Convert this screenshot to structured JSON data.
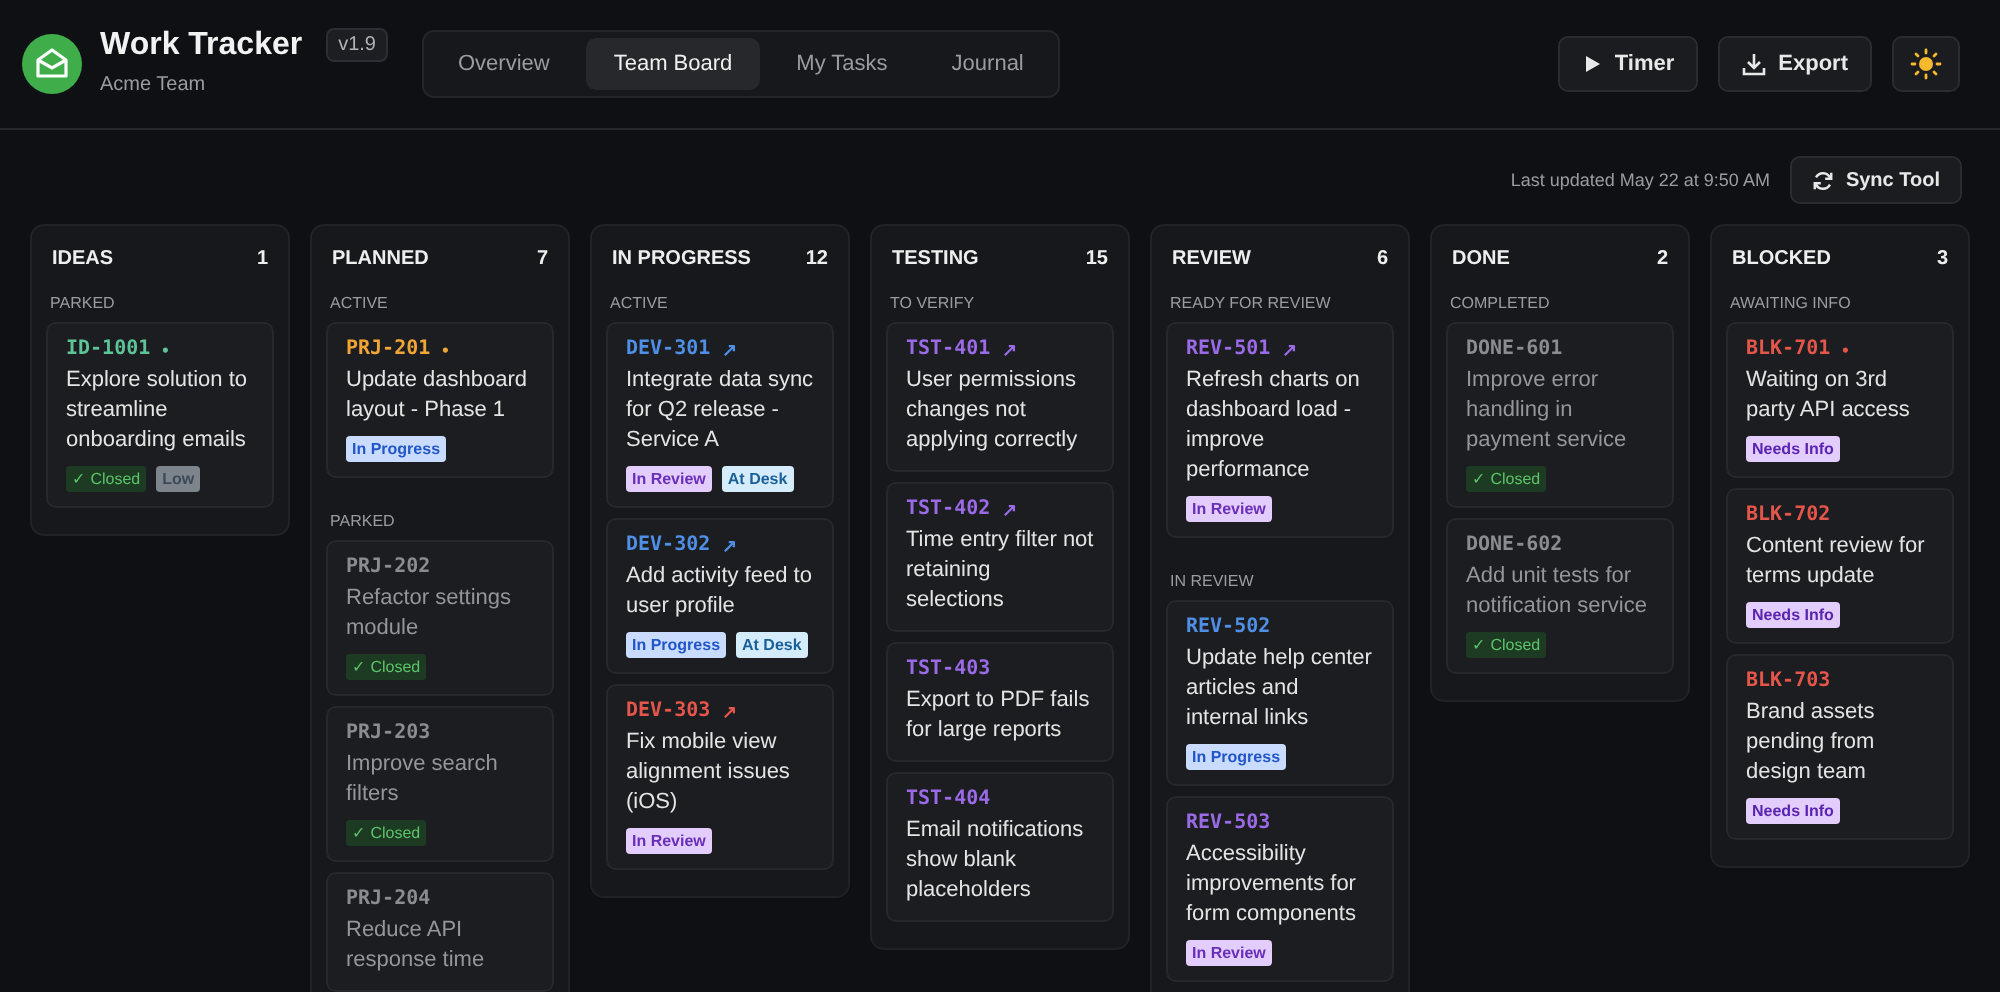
{
  "app": {
    "title": "Work Tracker",
    "version": "v1.9",
    "team": "Acme Team"
  },
  "tabs": [
    {
      "label": "Overview",
      "selected": false
    },
    {
      "label": "Team Board",
      "selected": true
    },
    {
      "label": "My Tasks",
      "selected": false
    },
    {
      "label": "Journal",
      "selected": false
    }
  ],
  "actions": [
    {
      "kind": "timer",
      "label": "Timer"
    },
    {
      "kind": "export",
      "label": "Export"
    },
    {
      "kind": "theme"
    }
  ],
  "last_updated": "Last updated May 22 at 9:50 AM",
  "sync_button": "Sync Tool",
  "columns": [
    {
      "title": "IDEAS",
      "count": "1",
      "sections": [
        {
          "label": "PARKED",
          "cards": [
            {
              "id": "ID-1001",
              "color": "#5cc497",
              "marker": "•",
              "muted": false,
              "text": "Explore solution to streamline onboarding emails",
              "tags": [
                {
                  "kind": "closed",
                  "label": "✓ Closed"
                },
                {
                  "kind": "low",
                  "label": "Low"
                }
              ]
            }
          ]
        }
      ]
    },
    {
      "title": "PLANNED",
      "count": "7",
      "sections": [
        {
          "label": "ACTIVE",
          "cards": [
            {
              "id": "PRJ-201",
              "color": "#f0a535",
              "marker": "•",
              "muted": false,
              "text": "Update dashboard layout - Phase 1",
              "tags": [
                {
                  "kind": "progress",
                  "label": "In Progress"
                }
              ]
            }
          ]
        },
        {
          "label": "PARKED",
          "cards": [
            {
              "id": "PRJ-202",
              "color": "#8a8c90",
              "muted": true,
              "text": "Refactor settings module",
              "tags": [
                {
                  "kind": "closed",
                  "label": "✓ Closed"
                }
              ]
            },
            {
              "id": "PRJ-203",
              "color": "#8a8c90",
              "muted": true,
              "text": "Improve search filters",
              "tags": [
                {
                  "kind": "closed",
                  "label": "✓ Closed"
                }
              ]
            },
            {
              "id": "PRJ-204",
              "color": "#8a8c90",
              "muted": true,
              "text": "Reduce API response time"
            }
          ]
        }
      ]
    },
    {
      "title": "IN PROGRESS",
      "count": "12",
      "sections": [
        {
          "label": "ACTIVE",
          "cards": [
            {
              "id": "DEV-301",
              "color": "#4f8fe6",
              "marker": "↗",
              "muted": false,
              "text": "Integrate data sync for Q2 release - Service A",
              "tags": [
                {
                  "kind": "review",
                  "label": "In Review"
                },
                {
                  "kind": "desk",
                  "label": "At Desk"
                }
              ]
            },
            {
              "id": "DEV-302",
              "color": "#4f8fe6",
              "marker": "↗",
              "muted": false,
              "text": "Add activity feed to user profile",
              "tags": [
                {
                  "kind": "progress",
                  "label": "In Progress"
                },
                {
                  "kind": "desk",
                  "label": "At Desk"
                }
              ]
            },
            {
              "id": "DEV-303",
              "color": "#e5564a",
              "marker": "↗",
              "muted": false,
              "text": "Fix mobile view alignment issues (iOS)",
              "tags": [
                {
                  "kind": "review",
                  "label": "In Review"
                }
              ]
            }
          ]
        }
      ]
    },
    {
      "title": "TESTING",
      "count": "15",
      "sections": [
        {
          "label": "TO VERIFY",
          "cards": [
            {
              "id": "TST-401",
              "color": "#9b6ae6",
              "marker": "↗",
              "muted": false,
              "text": "User permissions changes not applying correctly"
            },
            {
              "id": "TST-402",
              "color": "#9b6ae6",
              "marker": "↗",
              "muted": false,
              "text": "Time entry filter not retaining selections"
            },
            {
              "id": "TST-403",
              "color": "#9b6ae6",
              "muted": false,
              "text": "Export to PDF fails for large reports"
            },
            {
              "id": "TST-404",
              "color": "#9b6ae6",
              "muted": false,
              "text": "Email notifications show blank placeholders"
            }
          ]
        }
      ]
    },
    {
      "title": "REVIEW",
      "count": "6",
      "sections": [
        {
          "label": "READY FOR REVIEW",
          "cards": [
            {
              "id": "REV-501",
              "color": "#9b6ae6",
              "marker": "↗",
              "muted": false,
              "text": "Refresh charts on dashboard load - improve performance",
              "tags": [
                {
                  "kind": "review",
                  "label": "In Review"
                }
              ]
            }
          ]
        },
        {
          "label": "IN REVIEW",
          "cards": [
            {
              "id": "REV-502",
              "color": "#4f8fe6",
              "muted": false,
              "text": "Update help center articles and internal links",
              "tags": [
                {
                  "kind": "progress",
                  "label": "In Progress"
                }
              ]
            },
            {
              "id": "REV-503",
              "color": "#9b6ae6",
              "muted": false,
              "text": "Accessibility improvements for form components",
              "tags": [
                {
                  "kind": "review",
                  "label": "In Review"
                }
              ]
            }
          ]
        }
      ]
    },
    {
      "title": "DONE",
      "count": "2",
      "sections": [
        {
          "label": "COMPLETED",
          "cards": [
            {
              "id": "DONE-601",
              "color": "#8a8c90",
              "muted": true,
              "text": "Improve error handling in payment service",
              "tags": [
                {
                  "kind": "closed",
                  "label": "✓ Closed"
                }
              ]
            },
            {
              "id": "DONE-602",
              "color": "#8a8c90",
              "muted": true,
              "text": "Add unit tests for notification service",
              "tags": [
                {
                  "kind": "closed",
                  "label": "✓ Closed"
                }
              ]
            }
          ]
        }
      ]
    },
    {
      "title": "BLOCKED",
      "count": "3",
      "sections": [
        {
          "label": "AWAITING INFO",
          "cards": [
            {
              "id": "BLK-701",
              "color": "#e5564a",
              "marker": "•",
              "muted": false,
              "text": "Waiting on 3rd party API access",
              "tags": [
                {
                  "kind": "info",
                  "label": "Needs Info"
                }
              ]
            },
            {
              "id": "BLK-702",
              "color": "#e5564a",
              "muted": false,
              "text": "Content review for terms update",
              "tags": [
                {
                  "kind": "info",
                  "label": "Needs Info"
                }
              ]
            },
            {
              "id": "BLK-703",
              "color": "#e5564a",
              "muted": false,
              "text": "Brand assets pending from design team",
              "tags": [
                {
                  "kind": "info",
                  "label": "Needs Info"
                }
              ]
            }
          ]
        }
      ]
    }
  ]
}
